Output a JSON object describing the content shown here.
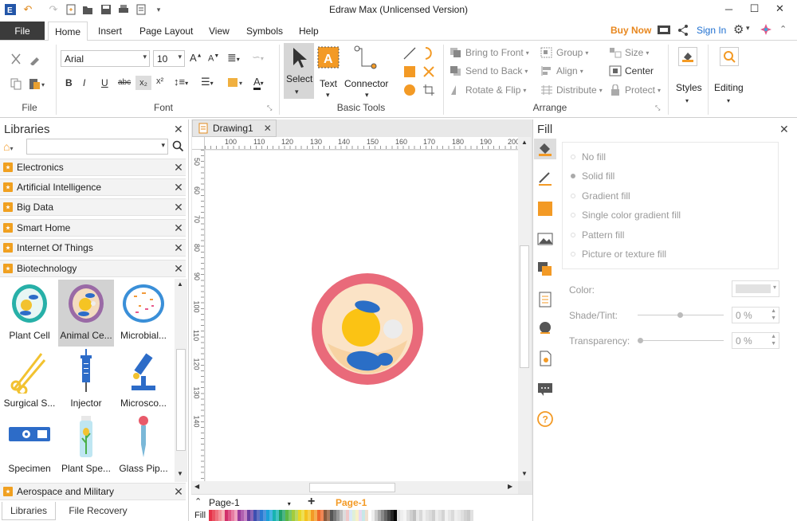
{
  "window": {
    "title": "Edraw Max (Unlicensed Version)"
  },
  "menu": {
    "file": "File",
    "tabs": [
      "Home",
      "Insert",
      "Page Layout",
      "View",
      "Symbols",
      "Help"
    ],
    "buy_now": "Buy Now",
    "sign_in": "Sign In"
  },
  "ribbon": {
    "font_name": "Arial",
    "font_size": "10",
    "groups": {
      "file": "File",
      "font": "Font",
      "basic_tools": "Basic Tools",
      "arrange": "Arrange"
    },
    "basic": {
      "select": "Select",
      "text": "Text",
      "connector": "Connector"
    },
    "arrange": {
      "bring_to_front": "Bring to Front",
      "send_to_back": "Send to Back",
      "rotate_flip": "Rotate & Flip",
      "group": "Group",
      "align": "Align",
      "distribute": "Distribute",
      "size": "Size",
      "center": "Center",
      "protect": "Protect"
    },
    "styles": "Styles",
    "editing": "Editing"
  },
  "libraries": {
    "title": "Libraries",
    "search_value": "",
    "items": [
      "Electronics",
      "Artificial Intelligence",
      "Big Data",
      "Smart Home",
      "Internet Of Things",
      "Biotechnology"
    ],
    "shapes": [
      {
        "label": "Plant Cell"
      },
      {
        "label": "Animal Ce..."
      },
      {
        "label": "Microbial..."
      },
      {
        "label": "Surgical S..."
      },
      {
        "label": "Injector"
      },
      {
        "label": "Microsco..."
      },
      {
        "label": "Specimen"
      },
      {
        "label": "Plant Spe..."
      },
      {
        "label": "Glass Pip..."
      }
    ],
    "footer_item": "Aerospace and Military",
    "bottom_tabs": [
      "Libraries",
      "File Recovery"
    ]
  },
  "document": {
    "tab": "Drawing1",
    "ruler_h": [
      "100",
      "110",
      "120",
      "130",
      "140",
      "150",
      "160",
      "170",
      "180",
      "190",
      "200"
    ],
    "ruler_v": [
      "50",
      "60",
      "70",
      "80",
      "90",
      "100",
      "110",
      "120",
      "130",
      "140"
    ],
    "page_select": "Page-1",
    "page_tab": "Page-1",
    "fill_label": "Fill"
  },
  "fill_panel": {
    "title": "Fill",
    "options": [
      "No fill",
      "Solid fill",
      "Gradient fill",
      "Single color gradient fill",
      "Pattern fill",
      "Picture or texture fill"
    ],
    "selected": "Solid fill",
    "color_label": "Color:",
    "shade_label": "Shade/Tint:",
    "shade_value": "0 %",
    "transparency_label": "Transparency:",
    "transparency_value": "0 %"
  },
  "colors": {
    "accent_orange": "#e8871e",
    "file_tab": "#3b3b3b",
    "link_blue": "#1e6fd0",
    "page_tab_orange": "#f39a25"
  }
}
